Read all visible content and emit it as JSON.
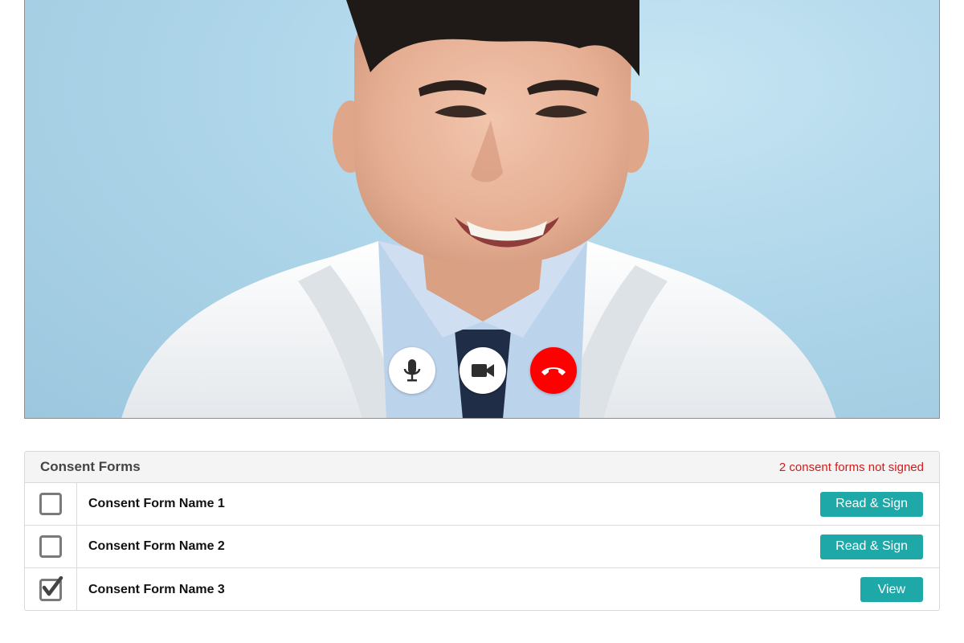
{
  "video": {
    "controls": [
      {
        "name": "mic-button",
        "icon": "microphone-icon"
      },
      {
        "name": "camera-button",
        "icon": "video-camera-icon"
      },
      {
        "name": "end-call-button",
        "icon": "hang-up-icon"
      }
    ],
    "end_call_color": "#ff0000"
  },
  "consent": {
    "title": "Consent Forms",
    "status": "2 consent forms not signed",
    "status_color": "#d01c1c",
    "accent_color": "#1fa8a8",
    "rows": [
      {
        "name": "Consent Form Name 1",
        "checked": false,
        "action": "Read & Sign"
      },
      {
        "name": "Consent Form Name 2",
        "checked": false,
        "action": "Read & Sign"
      },
      {
        "name": "Consent Form Name 3",
        "checked": true,
        "action": "View"
      }
    ]
  }
}
